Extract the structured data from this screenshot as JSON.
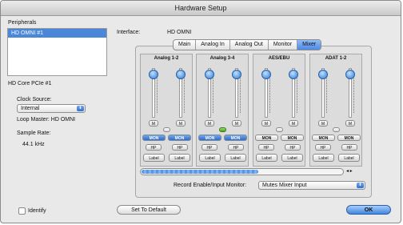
{
  "window": {
    "title": "Hardware Setup"
  },
  "peripherals": {
    "label": "Peripherals",
    "items": [
      "HD OMNI #1"
    ]
  },
  "device_label": "HD Core PCIe #1",
  "clock_source": {
    "label": "Clock Source:",
    "value": "Internal"
  },
  "loop_master": "Loop Master: HD OMNI",
  "sample_rate": {
    "label": "Sample Rate:",
    "value": "44.1 kHz"
  },
  "interface": {
    "label": "Interface:",
    "value": "HD OMNI"
  },
  "tabs": [
    "Main",
    "Analog In",
    "Analog Out",
    "Monitor",
    "Mixer"
  ],
  "strips": [
    {
      "name": "Analog 1-2",
      "m": "M",
      "mon": "MON",
      "hp": "HP",
      "label": "Label"
    },
    {
      "name": "Analog 3-4",
      "m": "M",
      "mon": "MON",
      "hp": "HP",
      "label": "Label"
    },
    {
      "name": "AES/EBU",
      "m": "M",
      "mon": "MON",
      "hp": "HP",
      "label": "Label"
    },
    {
      "name": "ADAT 1-2",
      "m": "M",
      "mon": "MON",
      "hp": "HP",
      "label": "Label"
    }
  ],
  "record_monitor": {
    "label": "Record Enable/Input Monitor:",
    "value": "Mutes Mixer Input"
  },
  "buttons": {
    "set_default": "Set To Default",
    "ok": "OK"
  },
  "identify": {
    "label": "Identify",
    "checked": false
  },
  "scroll_arrows": "◂ ▸",
  "colors": {
    "accent": "#3f86e0",
    "selection": "#4a87d8",
    "active_green": "#4aa21c"
  }
}
